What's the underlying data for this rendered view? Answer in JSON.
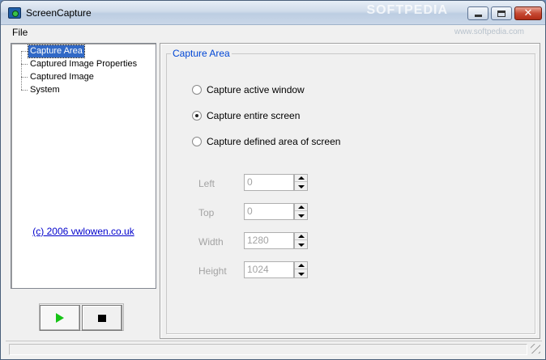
{
  "window": {
    "title": "ScreenCapture",
    "watermark": "SOFTPEDIA",
    "watermark_sub": "www.softpedia.com"
  },
  "menu": {
    "file": "File"
  },
  "tree": {
    "items": [
      {
        "label": "Capture Area",
        "selected": true
      },
      {
        "label": "Captured Image Properties",
        "selected": false
      },
      {
        "label": "Captured Image",
        "selected": false
      },
      {
        "label": "System",
        "selected": false
      }
    ],
    "copyright": "(c) 2006 vwlowen.co.uk"
  },
  "controls": {
    "play_icon": "play-icon",
    "stop_icon": "stop-icon"
  },
  "capture_area": {
    "legend": "Capture Area",
    "options": [
      {
        "label": "Capture active window",
        "checked": false
      },
      {
        "label": "Capture entire screen",
        "checked": true
      },
      {
        "label": "Capture defined area of screen",
        "checked": false
      }
    ],
    "fields": [
      {
        "label": "Left",
        "value": "0"
      },
      {
        "label": "Top",
        "value": "0"
      },
      {
        "label": "Width",
        "value": "1280"
      },
      {
        "label": "Height",
        "value": "1024"
      }
    ]
  },
  "colors": {
    "legend": "#0046d5",
    "link": "#0000cc",
    "selection": "#3169c6",
    "play": "#16c416"
  }
}
